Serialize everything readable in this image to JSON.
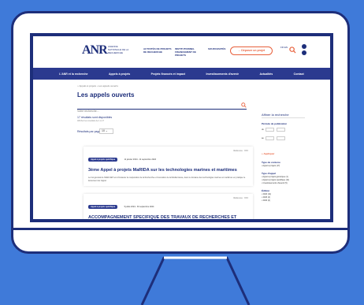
{
  "colors": {
    "background": "#3f7ad9",
    "monitor": "#1d2e7a",
    "navbar": "#2b3a8f",
    "accent": "#e8603c"
  },
  "header": {
    "logo": "ANR",
    "logo_sub": "AGENCE NATIONALE DE LA RECHERCHE",
    "nav_items": [
      "ACTIVITÉS DE PROJETS DE RECHERCHE",
      "INSTITUTIONNEL FINANCEMENT DE PROJETS",
      "SOURCES/ITÉS"
    ],
    "deposit_label": "→ Déposer un projet",
    "lang": "FR EN"
  },
  "navbar": {
    "items": [
      "L'ANR et la recherche",
      "Appels à projets",
      "Projets financés et impact",
      "Investissements d'avenir",
      "Actualités",
      "Contact"
    ]
  },
  "main": {
    "breadcrumb": "⌂ Appels à projets › Les appels ouverts",
    "title": "Les appels ouverts",
    "search_placeholder": "Votre recherche...",
    "results_count": "17 résultats sont disponibles",
    "results_sub": "Affichez les résultats de 1 à 17",
    "per_page_label": "Résultats par page",
    "per_page_value": "10"
  },
  "cards": [
    {
      "tag": "Appel à projets spécifique",
      "dates": "11 janvier 2024 - 11 septembre 2024",
      "ref": "Référence : XXX",
      "title": "3ème Appel à projets MaRIDA sur les technologies marines et maritimes",
      "desc": "Le but général de l'ERA-NET est d'instaurer la coopération de la Recherche et Innovation de la Méditerranée, dans le domaine des technologies marines et maritimes en pratique le lancement de l'appel."
    },
    {
      "tag": "Appel à projets spécifique",
      "dates": "5 juillet 2024 - 30 septembre 2024",
      "ref": "Référence : XXX",
      "title": "ACCOMPAGNEMENT SPECIFIQUE DES TRAVAUX DE RECHERCHES ET D'INNOVATION DEFENSE - Appel à projet thématique sur les Technologies",
      "desc": ""
    }
  ],
  "sidebar": {
    "title": "Affiner la recherche",
    "pub_method": "Période de publication",
    "date_from": "du",
    "date_to": "au",
    "apply": "+ Appliquer",
    "content_type": "Type de contenu",
    "content_item": "• Appel à projets (17)",
    "call_type": "Type d'appel",
    "call_items": [
      "• Appel à projets générique (1)",
      "• Appel à projets spécifique (11)",
      "• Investissements d'avenir (5)"
    ],
    "edition": "Édition",
    "edition_items": [
      "• 2024 (11)",
      "• 2023 (4)",
      "• 2022 (2)"
    ]
  }
}
